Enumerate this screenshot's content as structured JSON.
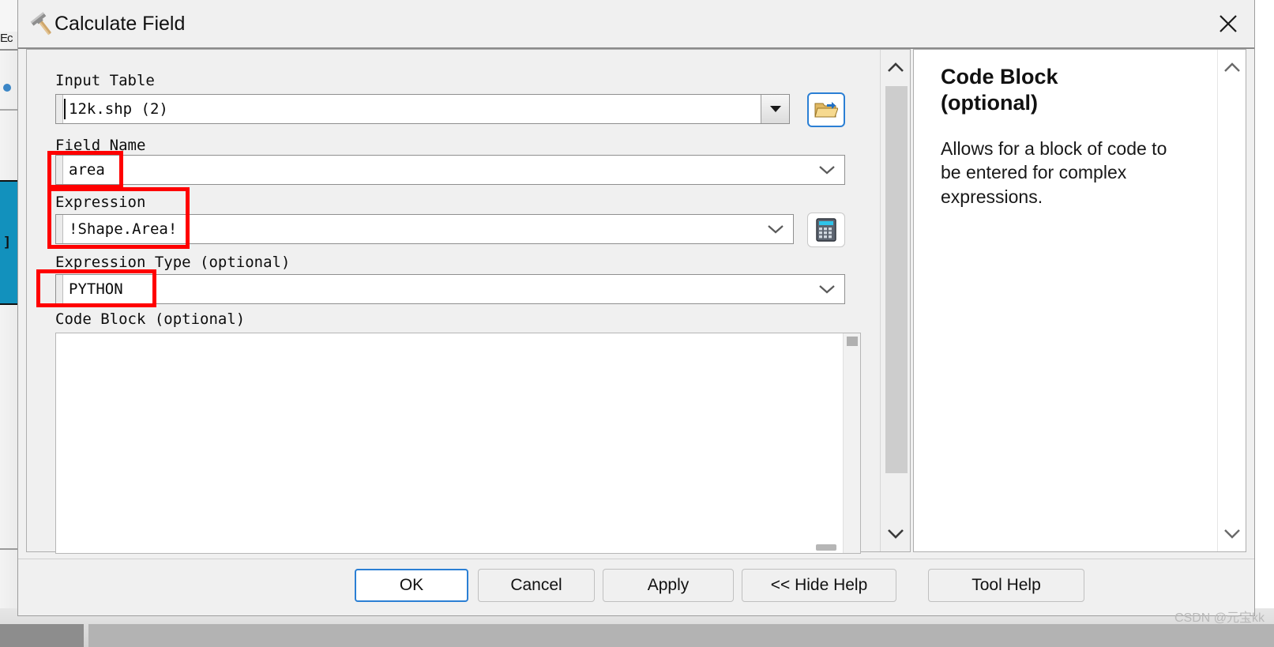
{
  "window": {
    "title": "Calculate Field",
    "title_icon": "hammer-tool-icon",
    "close_icon": "close-icon"
  },
  "params": [
    {
      "key": "input_table",
      "label": "Input Table",
      "value": "12k.shp (2)",
      "control": "combo-classic",
      "has_caret": true,
      "browse_icon": "open-folder-icon",
      "annotated": false
    },
    {
      "key": "field_name",
      "label": "Field Name",
      "value": "area",
      "control": "combo-flat",
      "annotated": true
    },
    {
      "key": "expression",
      "label": "Expression",
      "value": "!Shape.Area!",
      "control": "combo-flat",
      "side_icon": "calculator-icon",
      "annotated": true
    },
    {
      "key": "expression_type",
      "label": "Expression Type (optional)",
      "value": "PYTHON",
      "control": "combo-flat",
      "annotated": true
    },
    {
      "key": "code_block",
      "label": "Code Block (optional)",
      "value": "",
      "control": "textarea",
      "annotated": false
    }
  ],
  "help": {
    "title": "Code Block\n(optional)",
    "title_line1": "Code Block",
    "title_line2": "(optional)",
    "body": "Allows for a block of code to be entered for complex expressions."
  },
  "footer": {
    "buttons": [
      {
        "key": "ok",
        "label": "OK",
        "primary": true
      },
      {
        "key": "cancel",
        "label": "Cancel",
        "primary": false
      },
      {
        "key": "apply",
        "label": "Apply",
        "primary": false
      },
      {
        "key": "hide_help",
        "label": "<< Hide Help",
        "primary": false
      },
      {
        "key": "tool_help",
        "label": "Tool Help",
        "primary": false
      }
    ]
  },
  "background": {
    "text_fragment": "Ec",
    "selected_label": "]"
  },
  "watermark": "CSDN @元宝kk",
  "colors": {
    "accent_blue": "#2b7fd4",
    "annotation_red": "#ff0000",
    "dialog_bg": "#f0f0f0",
    "selected_teal": "#1291bd"
  }
}
